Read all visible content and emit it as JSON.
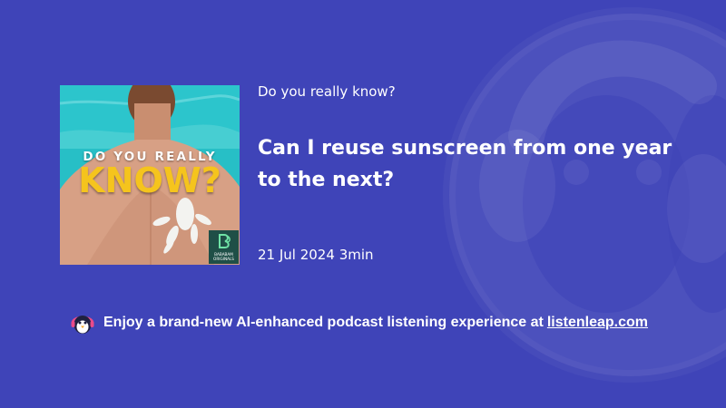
{
  "background_color": "#3f44b8",
  "podcast": {
    "show_name": "Do you really know?",
    "episode_title": "Can I reuse sunscreen from one year to the next?",
    "date": "21 Jul 2024",
    "duration": "3min"
  },
  "cover": {
    "line1": "DO YOU REALLY",
    "line2": "KNOW?",
    "badge_line1": "BABABAM",
    "badge_line2": "ORIGINALS",
    "pool_color": "#27bfc6",
    "title_color": "#f5c41d",
    "badge_color": "#1f4f47"
  },
  "promo": {
    "text": "Enjoy a brand-new AI-enhanced podcast listening experience at",
    "link_text": "listenleap.com",
    "icon": "penguin-headphones-icon"
  },
  "icons": {
    "background_logo": "listenleap-logo-icon",
    "badge_logo": "bababam-logo-icon"
  }
}
